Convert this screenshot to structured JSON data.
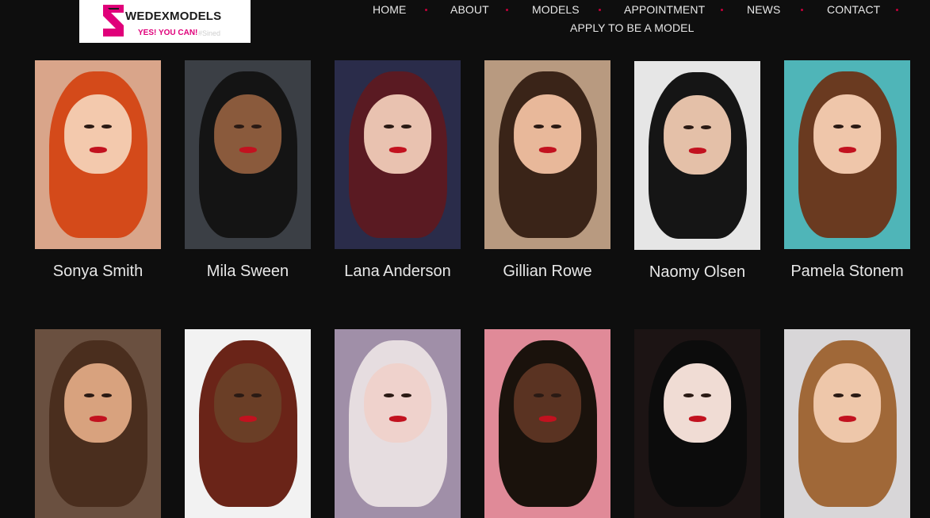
{
  "logo": {
    "brand": "WEDEXMODELS",
    "tagline": "YES! YOU CAN!",
    "faint_text": "#Sined",
    "accent": "#e0007a"
  },
  "nav": {
    "items": [
      "HOME",
      "ABOUT",
      "MODELS",
      "APPOINTMENT",
      "NEWS",
      "CONTACT",
      "APPLY TO BE A MODEL"
    ],
    "separator_color": "#c4003a"
  },
  "models": [
    {
      "name": "Sonya Smith",
      "bg": "#d9a58a",
      "hair": "#d44a1a",
      "skin": "#f3c9ad"
    },
    {
      "name": "Mila Sween",
      "bg": "#3b3f45",
      "hair": "#141414",
      "skin": "#8a5a3c"
    },
    {
      "name": "Lana Anderson",
      "bg": "#2a2c4a",
      "hair": "#5a1a22",
      "skin": "#e9c2b0"
    },
    {
      "name": "Gillian Rowe",
      "bg": "#b89a80",
      "hair": "#3a2418",
      "skin": "#e8b89a"
    },
    {
      "name": "Naomy Olsen",
      "bg": "#e6e6e6",
      "hair": "#151515",
      "skin": "#e4c0a8"
    },
    {
      "name": "Pamela Stonem",
      "bg": "#4fb5b8",
      "hair": "#6a3a20",
      "skin": "#efc6aa"
    },
    {
      "name": "",
      "bg": "#6a5040",
      "hair": "#4a2e1e",
      "skin": "#d8a27e"
    },
    {
      "name": "",
      "bg": "#f2f2f2",
      "hair": "#6a2418",
      "skin": "#6a3e26"
    },
    {
      "name": "",
      "bg": "#a08fa8",
      "hair": "#e6dde0",
      "skin": "#efd2cc"
    },
    {
      "name": "",
      "bg": "#e08a98",
      "hair": "#1a120c",
      "skin": "#5a3322"
    },
    {
      "name": "",
      "bg": "#1c1414",
      "hair": "#0c0c0c",
      "skin": "#f0dcd4"
    },
    {
      "name": "",
      "bg": "#d8d6d8",
      "hair": "#a06838",
      "skin": "#eec7aa"
    }
  ]
}
